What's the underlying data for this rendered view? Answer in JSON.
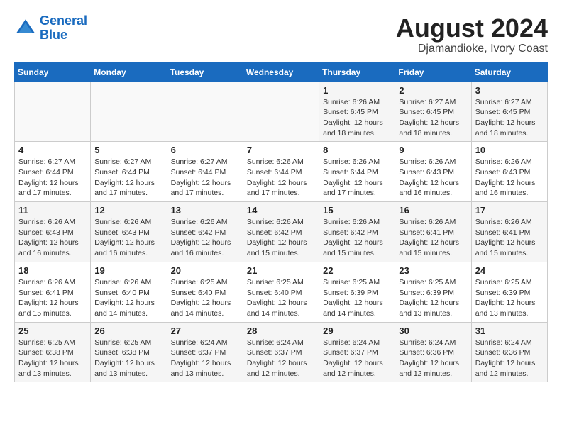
{
  "header": {
    "logo_line1": "General",
    "logo_line2": "Blue",
    "title": "August 2024",
    "subtitle": "Djamandioke, Ivory Coast"
  },
  "weekdays": [
    "Sunday",
    "Monday",
    "Tuesday",
    "Wednesday",
    "Thursday",
    "Friday",
    "Saturday"
  ],
  "weeks": [
    [
      {
        "day": "",
        "info": ""
      },
      {
        "day": "",
        "info": ""
      },
      {
        "day": "",
        "info": ""
      },
      {
        "day": "",
        "info": ""
      },
      {
        "day": "1",
        "info": "Sunrise: 6:26 AM\nSunset: 6:45 PM\nDaylight: 12 hours\nand 18 minutes."
      },
      {
        "day": "2",
        "info": "Sunrise: 6:27 AM\nSunset: 6:45 PM\nDaylight: 12 hours\nand 18 minutes."
      },
      {
        "day": "3",
        "info": "Sunrise: 6:27 AM\nSunset: 6:45 PM\nDaylight: 12 hours\nand 18 minutes."
      }
    ],
    [
      {
        "day": "4",
        "info": "Sunrise: 6:27 AM\nSunset: 6:44 PM\nDaylight: 12 hours\nand 17 minutes."
      },
      {
        "day": "5",
        "info": "Sunrise: 6:27 AM\nSunset: 6:44 PM\nDaylight: 12 hours\nand 17 minutes."
      },
      {
        "day": "6",
        "info": "Sunrise: 6:27 AM\nSunset: 6:44 PM\nDaylight: 12 hours\nand 17 minutes."
      },
      {
        "day": "7",
        "info": "Sunrise: 6:26 AM\nSunset: 6:44 PM\nDaylight: 12 hours\nand 17 minutes."
      },
      {
        "day": "8",
        "info": "Sunrise: 6:26 AM\nSunset: 6:44 PM\nDaylight: 12 hours\nand 17 minutes."
      },
      {
        "day": "9",
        "info": "Sunrise: 6:26 AM\nSunset: 6:43 PM\nDaylight: 12 hours\nand 16 minutes."
      },
      {
        "day": "10",
        "info": "Sunrise: 6:26 AM\nSunset: 6:43 PM\nDaylight: 12 hours\nand 16 minutes."
      }
    ],
    [
      {
        "day": "11",
        "info": "Sunrise: 6:26 AM\nSunset: 6:43 PM\nDaylight: 12 hours\nand 16 minutes."
      },
      {
        "day": "12",
        "info": "Sunrise: 6:26 AM\nSunset: 6:43 PM\nDaylight: 12 hours\nand 16 minutes."
      },
      {
        "day": "13",
        "info": "Sunrise: 6:26 AM\nSunset: 6:42 PM\nDaylight: 12 hours\nand 16 minutes."
      },
      {
        "day": "14",
        "info": "Sunrise: 6:26 AM\nSunset: 6:42 PM\nDaylight: 12 hours\nand 15 minutes."
      },
      {
        "day": "15",
        "info": "Sunrise: 6:26 AM\nSunset: 6:42 PM\nDaylight: 12 hours\nand 15 minutes."
      },
      {
        "day": "16",
        "info": "Sunrise: 6:26 AM\nSunset: 6:41 PM\nDaylight: 12 hours\nand 15 minutes."
      },
      {
        "day": "17",
        "info": "Sunrise: 6:26 AM\nSunset: 6:41 PM\nDaylight: 12 hours\nand 15 minutes."
      }
    ],
    [
      {
        "day": "18",
        "info": "Sunrise: 6:26 AM\nSunset: 6:41 PM\nDaylight: 12 hours\nand 15 minutes."
      },
      {
        "day": "19",
        "info": "Sunrise: 6:26 AM\nSunset: 6:40 PM\nDaylight: 12 hours\nand 14 minutes."
      },
      {
        "day": "20",
        "info": "Sunrise: 6:25 AM\nSunset: 6:40 PM\nDaylight: 12 hours\nand 14 minutes."
      },
      {
        "day": "21",
        "info": "Sunrise: 6:25 AM\nSunset: 6:40 PM\nDaylight: 12 hours\nand 14 minutes."
      },
      {
        "day": "22",
        "info": "Sunrise: 6:25 AM\nSunset: 6:39 PM\nDaylight: 12 hours\nand 14 minutes."
      },
      {
        "day": "23",
        "info": "Sunrise: 6:25 AM\nSunset: 6:39 PM\nDaylight: 12 hours\nand 13 minutes."
      },
      {
        "day": "24",
        "info": "Sunrise: 6:25 AM\nSunset: 6:39 PM\nDaylight: 12 hours\nand 13 minutes."
      }
    ],
    [
      {
        "day": "25",
        "info": "Sunrise: 6:25 AM\nSunset: 6:38 PM\nDaylight: 12 hours\nand 13 minutes."
      },
      {
        "day": "26",
        "info": "Sunrise: 6:25 AM\nSunset: 6:38 PM\nDaylight: 12 hours\nand 13 minutes."
      },
      {
        "day": "27",
        "info": "Sunrise: 6:24 AM\nSunset: 6:37 PM\nDaylight: 12 hours\nand 13 minutes."
      },
      {
        "day": "28",
        "info": "Sunrise: 6:24 AM\nSunset: 6:37 PM\nDaylight: 12 hours\nand 12 minutes."
      },
      {
        "day": "29",
        "info": "Sunrise: 6:24 AM\nSunset: 6:37 PM\nDaylight: 12 hours\nand 12 minutes."
      },
      {
        "day": "30",
        "info": "Sunrise: 6:24 AM\nSunset: 6:36 PM\nDaylight: 12 hours\nand 12 minutes."
      },
      {
        "day": "31",
        "info": "Sunrise: 6:24 AM\nSunset: 6:36 PM\nDaylight: 12 hours\nand 12 minutes."
      }
    ]
  ]
}
